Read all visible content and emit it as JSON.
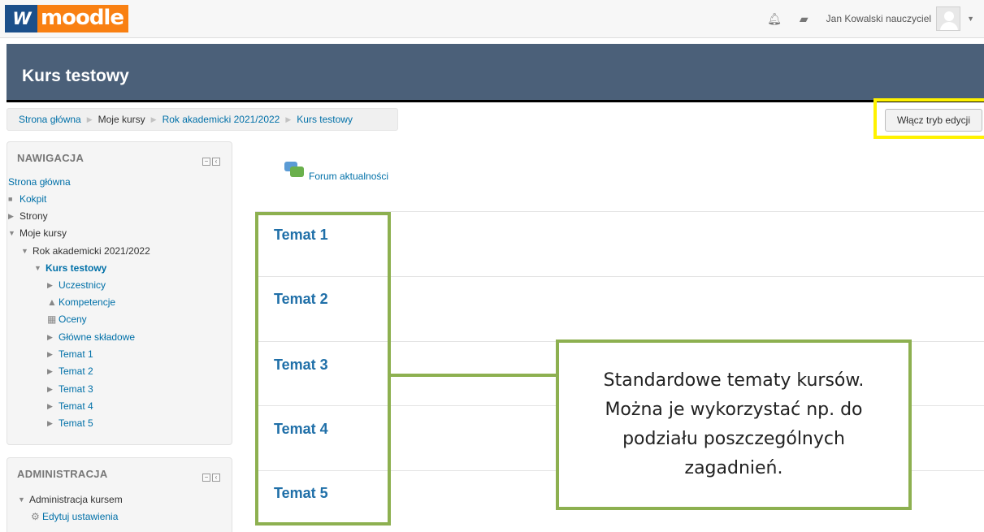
{
  "navbar": {
    "logo_mark": "W",
    "logo_word": "moodle",
    "user_name": "Jan Kowalski nauczyciel",
    "icons": [
      "notification-bell-icon",
      "messages-icon",
      "user-menu-caret-icon"
    ]
  },
  "course": {
    "title": "Kurs testowy"
  },
  "breadcrumb": [
    {
      "label": "Strona główna"
    },
    {
      "label": "Moje kursy"
    },
    {
      "label": "Rok akademicki 2021/2022"
    },
    {
      "label": "Kurs testowy"
    }
  ],
  "edit_button": {
    "label": "Włącz tryb edycji"
  },
  "navigation_block": {
    "title": "NAWIGACJA",
    "items": [
      {
        "label": "Strona główna"
      },
      {
        "label": "Kokpit"
      },
      {
        "label": "Strony"
      },
      {
        "label": "Moje kursy"
      },
      {
        "label": "Rok akademicki 2021/2022"
      },
      {
        "label": "Kurs testowy"
      },
      {
        "label": "Uczestnicy"
      },
      {
        "label": "Kompetencje"
      },
      {
        "label": "Oceny"
      },
      {
        "label": "Główne składowe"
      },
      {
        "label": "Temat 1"
      },
      {
        "label": "Temat 2"
      },
      {
        "label": "Temat 3"
      },
      {
        "label": "Temat 4"
      },
      {
        "label": "Temat 5"
      }
    ]
  },
  "admin_block": {
    "title": "ADMINISTRACJA",
    "items": [
      {
        "label": "Administracja kursem"
      },
      {
        "label": "Edytuj ustawienia"
      }
    ]
  },
  "main": {
    "forum_link": "Forum aktualności",
    "topics": [
      "Temat 1",
      "Temat 2",
      "Temat 3",
      "Temat 4",
      "Temat 5"
    ]
  },
  "annotation": {
    "text": "Standardowe tematy kursów. Można je wykorzystać np. do podziału poszczególnych zagadnień.",
    "highlight_color": "#8db050",
    "edit_highlight_color": "#fff200"
  },
  "colors": {
    "header_bg": "#4b6079",
    "link": "#0070a8",
    "topic_title": "#1f6fa8",
    "logo_orange": "#f98012"
  }
}
